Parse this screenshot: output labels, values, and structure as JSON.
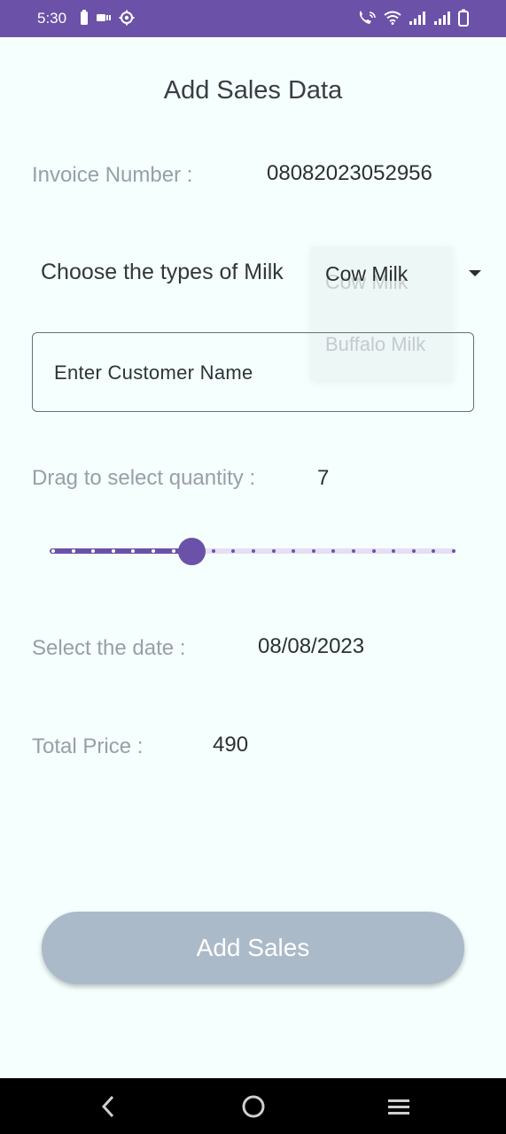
{
  "status_bar": {
    "time": "5:30",
    "bg_color": "#6b52a8",
    "left_icons": [
      "battery-saver-icon",
      "cast-icon",
      "settings-icon"
    ],
    "right_icons": [
      "wifi-calling-icon",
      "wifi-icon",
      "signal-1-icon",
      "signal-2-icon",
      "battery-icon"
    ]
  },
  "title": "Add Sales Data",
  "invoice": {
    "label": "Invoice Number :",
    "value": "08082023052956"
  },
  "milk": {
    "label": "Choose the types of Milk",
    "selected": "Cow Milk",
    "options": [
      "Cow Milk",
      "Buffalo Milk"
    ]
  },
  "customer": {
    "placeholder": "Enter Customer Name"
  },
  "quantity": {
    "label": "Drag to select quantity :",
    "value": "7",
    "slider_fraction": 0.35
  },
  "date": {
    "label": "Select the date :",
    "value": "08/08/2023"
  },
  "total": {
    "label": "Total Price :",
    "value": "490"
  },
  "add_button": {
    "label": "Add Sales"
  },
  "nav": {
    "icons": [
      "back-icon",
      "home-icon",
      "recents-icon"
    ]
  },
  "colors": {
    "accent": "#6b52a8",
    "button_disabled": "#abbac9",
    "background": "#f5fffe"
  }
}
